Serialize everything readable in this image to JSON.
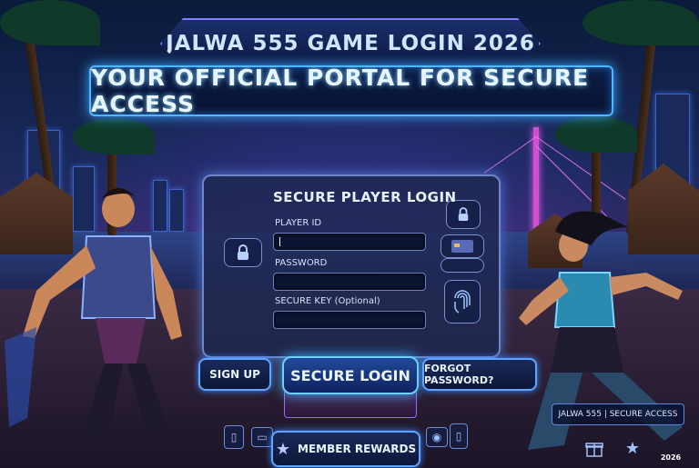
{
  "banner": {
    "title": "JALWA 555 GAME LOGIN 2026",
    "subtitle": "YOUR OFFICIAL PORTAL FOR SECURE ACCESS"
  },
  "login": {
    "title": "SECURE PLAYER LOGIN",
    "player_id_label": "PLAYER ID",
    "password_label": "PASSWORD",
    "secure_key_label": "SECURE KEY (Optional)"
  },
  "buttons": {
    "sign_up": "SIGN UP",
    "secure_login": "SECURE LOGIN",
    "forgot_password": "FORGOT PASSWORD?",
    "member_rewards": "MEMBER REWARDS"
  },
  "footer": {
    "tag": "JALWA 555 | SECURE ACCESS",
    "year": "2026"
  },
  "icons": {
    "lock": "lock-icon",
    "card": "card-icon",
    "fingerprint": "fingerprint-icon",
    "gift": "gift-icon",
    "star": "star-icon"
  },
  "colors": {
    "accent": "#4fb6ff",
    "neon_purple": "#8a7cff",
    "panel": "#1e2850"
  }
}
